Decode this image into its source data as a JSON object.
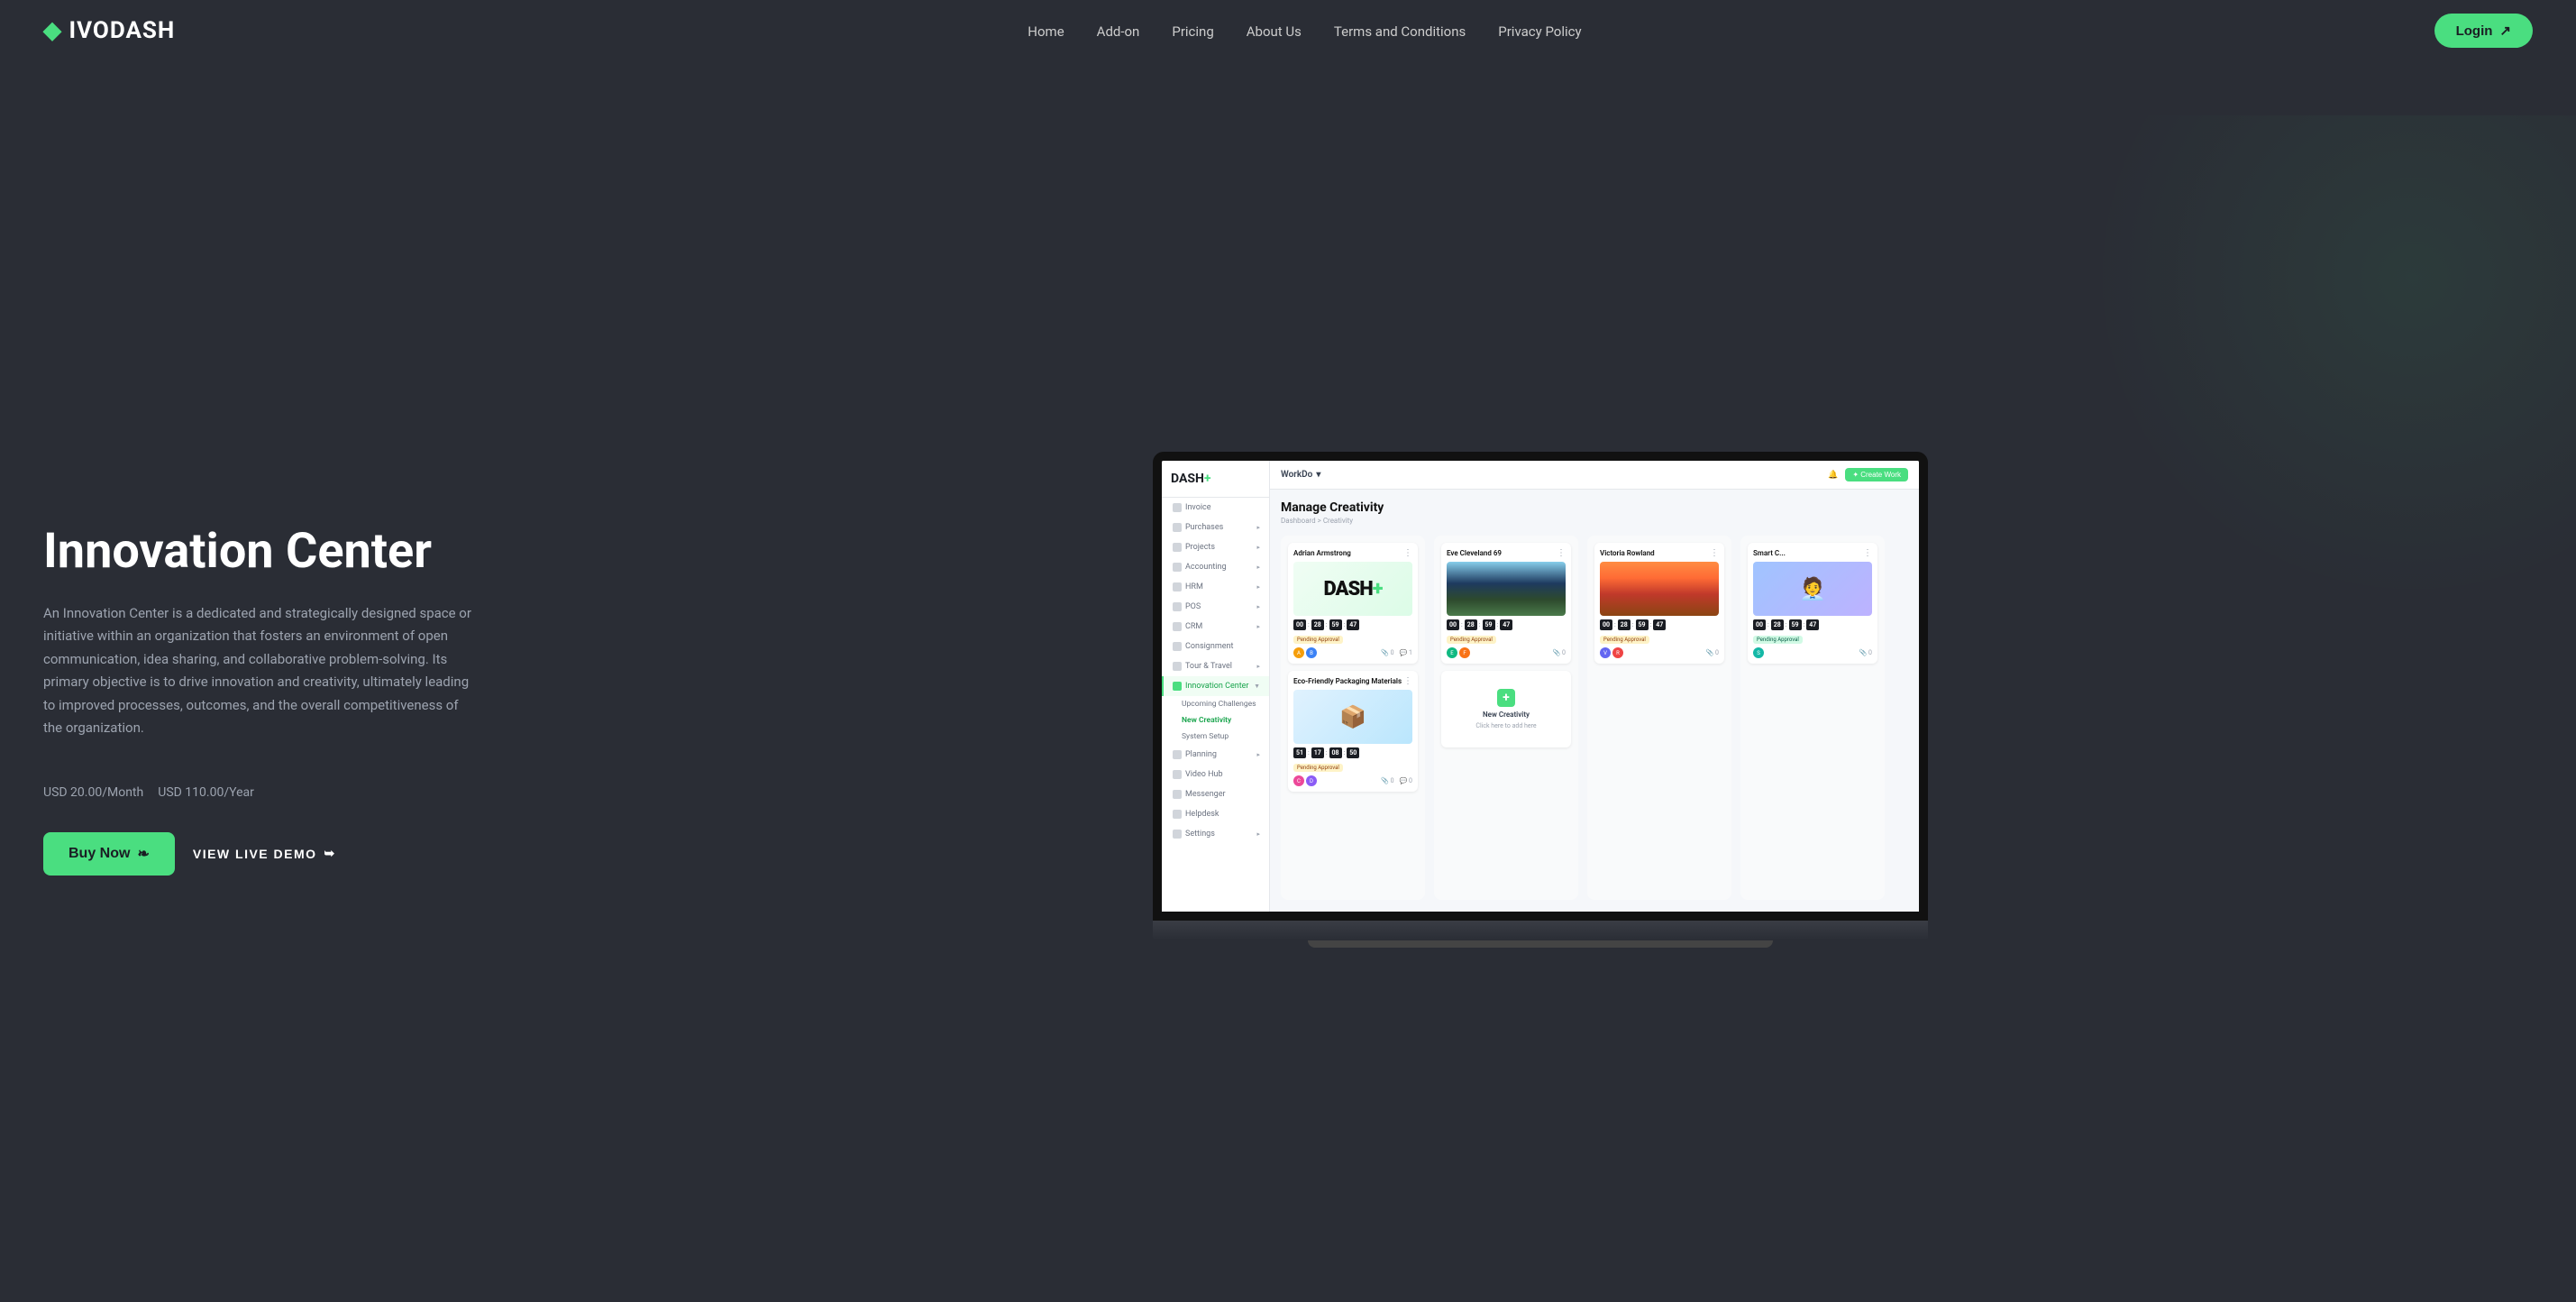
{
  "nav": {
    "logo": "IVODASH",
    "logo_prefix": "IVO",
    "logo_suffix": "DASH",
    "logo_plus": "+",
    "links": [
      {
        "label": "Home",
        "id": "home"
      },
      {
        "label": "Add-on",
        "id": "addon"
      },
      {
        "label": "Pricing",
        "id": "pricing"
      },
      {
        "label": "About Us",
        "id": "about"
      },
      {
        "label": "Terms and Conditions",
        "id": "terms"
      },
      {
        "label": "Privacy Policy",
        "id": "privacy"
      }
    ],
    "login_label": "Login"
  },
  "hero": {
    "title": "Innovation Center",
    "description": "An Innovation Center is a dedicated and strategically designed space or initiative within an organization that fosters an environment of open communication, idea sharing, and collaborative problem-solving. Its primary objective is to drive innovation and creativity, ultimately leading to improved processes, outcomes, and the overall competitiveness of the organization.",
    "price_monthly": "USD 20.00",
    "price_monthly_suffix": "/Month",
    "price_yearly": "USD 110.00",
    "price_yearly_suffix": "/Year",
    "buy_now_label": "Buy Now",
    "live_demo_label": "VIEW LIVE DEMO"
  },
  "dash_app": {
    "logo": "DASH",
    "logo_plus": "+",
    "workspace_label": "WorkDo",
    "workspace_arrow": "▾",
    "create_btn": "✦ Create Work",
    "page_title": "Manage Creativity",
    "breadcrumb": "Dashboard > Creativity",
    "sidebar_items": [
      {
        "label": "Invoice",
        "icon": "invoice"
      },
      {
        "label": "Purchases",
        "icon": "purchases",
        "has_arrow": true
      },
      {
        "label": "Projects",
        "icon": "projects",
        "has_arrow": true
      },
      {
        "label": "Accounting",
        "icon": "accounting",
        "has_arrow": true
      },
      {
        "label": "HRM",
        "icon": "hrm",
        "has_arrow": true
      },
      {
        "label": "POS",
        "icon": "pos",
        "has_arrow": true
      },
      {
        "label": "CRM",
        "icon": "crm",
        "has_arrow": true
      },
      {
        "label": "Consignment",
        "icon": "consignment"
      },
      {
        "label": "Tour & Travel",
        "icon": "tour",
        "has_arrow": true
      },
      {
        "label": "Innovation Center",
        "icon": "innovation",
        "active": true,
        "has_arrow": true
      },
      {
        "label": "Upcoming Challenges",
        "sub": true
      },
      {
        "label": "New Creativity",
        "sub": true
      },
      {
        "label": "System Setup",
        "sub": true
      },
      {
        "label": "Planning",
        "icon": "planning",
        "has_arrow": true
      },
      {
        "label": "Video Hub",
        "icon": "video"
      },
      {
        "label": "Messenger",
        "icon": "messenger"
      },
      {
        "label": "Helpdesk",
        "icon": "helpdesk"
      },
      {
        "label": "Settings",
        "icon": "settings",
        "has_arrow": true
      }
    ],
    "kanban_cols": [
      {
        "id": "col1",
        "cards": [
          {
            "id": "card-adrian",
            "title": "Adrian Armstrong",
            "image_type": "dash-logo",
            "timer": [
              "00",
              "28",
              "59",
              "47"
            ],
            "badge": "Pending Approval",
            "badge_type": "yellow",
            "attachments": "0",
            "comments": "1"
          },
          {
            "id": "card-packaging",
            "title": "Eco-Friendly Packaging Materials",
            "image_type": "packaging",
            "timer": [
              "51",
              "17",
              "08",
              "50"
            ],
            "badge": "Pending Approval",
            "badge_type": "yellow",
            "attachments": "0",
            "comments": "0"
          }
        ]
      },
      {
        "id": "col2",
        "cards": [
          {
            "id": "card-eve",
            "title": "Eve Cleveland 69",
            "image_type": "palms",
            "timer": [
              "00",
              "28",
              "59",
              "47"
            ],
            "badge": "Pending Approval",
            "badge_type": "yellow",
            "attachments": "0",
            "comments": ""
          },
          {
            "id": "card-new-creativity",
            "title": "New Creativity",
            "image_type": "new",
            "sub_label": "Click here to add here"
          }
        ]
      },
      {
        "id": "col3",
        "cards": [
          {
            "id": "card-victoria",
            "title": "Victoria Rowland",
            "image_type": "mountains",
            "timer": [
              "00",
              "28",
              "59",
              "47"
            ],
            "badge": "Pending Approval",
            "badge_type": "yellow",
            "attachments": "0",
            "comments": ""
          }
        ]
      },
      {
        "id": "col4",
        "cards": [
          {
            "id": "card-smart",
            "title": "Smart C...",
            "image_type": "person",
            "timer": [
              "00",
              "28",
              "59",
              "47"
            ],
            "badge": "Pending Approval",
            "badge_type": "green",
            "attachments": "0",
            "comments": ""
          }
        ]
      }
    ]
  }
}
